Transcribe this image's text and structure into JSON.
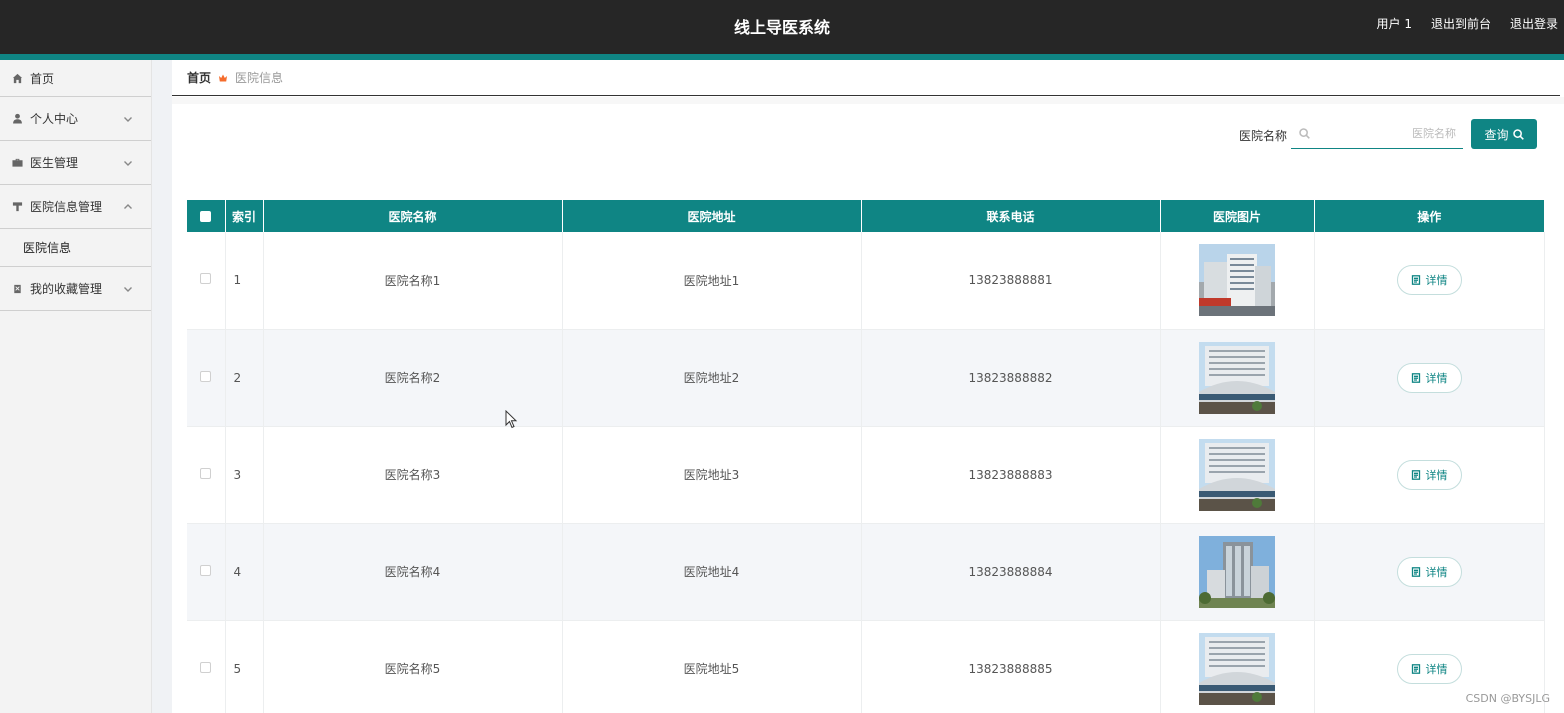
{
  "header": {
    "title": "线上导医系统",
    "links": [
      "用户 1",
      "退出到前台",
      "退出登录"
    ]
  },
  "sidebar": {
    "items": [
      {
        "label": "首页",
        "icon": "home-icon"
      },
      {
        "label": "个人中心",
        "icon": "user-icon",
        "expandable": true
      },
      {
        "label": "医生管理",
        "icon": "briefcase-icon",
        "expandable": true
      },
      {
        "label": "医院信息管理",
        "icon": "stamp-icon",
        "expandable": true,
        "expanded": true
      },
      {
        "label": "我的收藏管理",
        "icon": "clipboard-icon",
        "expandable": true
      }
    ],
    "submenu": [
      "医院信息"
    ]
  },
  "breadcrumb": {
    "home": "首页",
    "current": "医院信息"
  },
  "search": {
    "label": "医院名称",
    "placeholder": "医院名称",
    "value": "",
    "button_label": "查询"
  },
  "table": {
    "columns": [
      "索引",
      "医院名称",
      "医院地址",
      "联系电话",
      "医院图片",
      "操作"
    ],
    "rows": [
      {
        "index": "1",
        "name": "医院名称1",
        "address": "医院地址1",
        "phone": "13823888881",
        "image": "hospital-photo-a",
        "action": "详情"
      },
      {
        "index": "2",
        "name": "医院名称2",
        "address": "医院地址2",
        "phone": "13823888882",
        "image": "hospital-photo-b",
        "action": "详情"
      },
      {
        "index": "3",
        "name": "医院名称3",
        "address": "医院地址3",
        "phone": "13823888883",
        "image": "hospital-photo-b",
        "action": "详情"
      },
      {
        "index": "4",
        "name": "医院名称4",
        "address": "医院地址4",
        "phone": "13823888884",
        "image": "hospital-photo-c",
        "action": "详情"
      },
      {
        "index": "5",
        "name": "医院名称5",
        "address": "医院地址5",
        "phone": "13823888885",
        "image": "hospital-photo-b",
        "action": "详情"
      }
    ]
  },
  "watermark": "CSDN @BYSJLG",
  "colors": {
    "accent": "#0f8584",
    "topbar": "#262626",
    "breadcrumb_icon": "#f56c2c"
  }
}
